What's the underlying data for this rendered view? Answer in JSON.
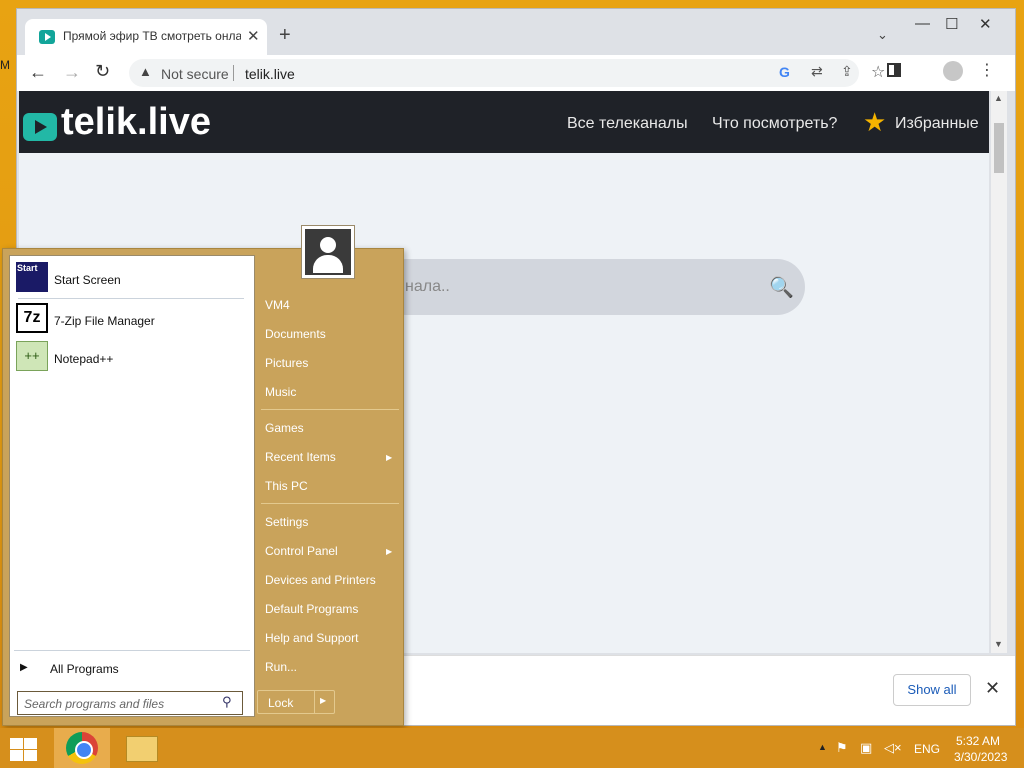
{
  "desktop": {
    "label": "M"
  },
  "browser": {
    "tab_title": "Прямой эфир ТВ смотреть онла",
    "tab_close": "✕",
    "new_tab": "+",
    "tab_search": "⌄",
    "window": {
      "minimize": "—",
      "maximize": "☐",
      "close": "✕"
    },
    "nav": {
      "back": "←",
      "forward": "→",
      "reload": "↻"
    },
    "omnibox": {
      "security_icon": "▲",
      "security_text": "Not secure",
      "url": "telik.live"
    },
    "toolbar_icons": {
      "google": "G",
      "translate": "⇄",
      "share": "⇪",
      "bookmark": "☆",
      "menu": "⋮"
    }
  },
  "site": {
    "logo": "telik.live",
    "nav": {
      "all_channels": "Все телеканалы",
      "what_to_watch": "Что посмотреть?",
      "favorites": "Избранные"
    },
    "favorites_icon": "★",
    "search_placeholder": "нала..",
    "search_icon": "🔍"
  },
  "scrollbar": {
    "up": "▲",
    "down": "▼"
  },
  "download_bar": {
    "show_all": "Show all",
    "close": "✕"
  },
  "start_menu": {
    "pinned": [
      {
        "label": "Start Screen",
        "icon": "Start"
      },
      {
        "label": "7-Zip File Manager",
        "icon": "7z"
      },
      {
        "label": "Notepad++",
        "icon": "++"
      }
    ],
    "all_programs": "All Programs",
    "all_programs_arrow": "▶",
    "search_placeholder": "Search programs and files",
    "search_icon": "⚲",
    "right_links": {
      "user": "VM4",
      "documents": "Documents",
      "pictures": "Pictures",
      "music": "Music",
      "games": "Games",
      "recent_items": "Recent Items",
      "this_pc": "This PC",
      "settings": "Settings",
      "control_panel": "Control Panel",
      "devices_printers": "Devices and Printers",
      "default_programs": "Default Programs",
      "help_support": "Help and Support",
      "run": "Run..."
    },
    "submenu_arrow": "▶",
    "lock": "Lock"
  },
  "taskbar": {
    "tray_up": "▲",
    "flag_icon": "⚑",
    "network_icon": "▣",
    "volume_icon": "◁×",
    "language": "ENG",
    "time": "5:32 AM",
    "date": "3/30/2023"
  }
}
